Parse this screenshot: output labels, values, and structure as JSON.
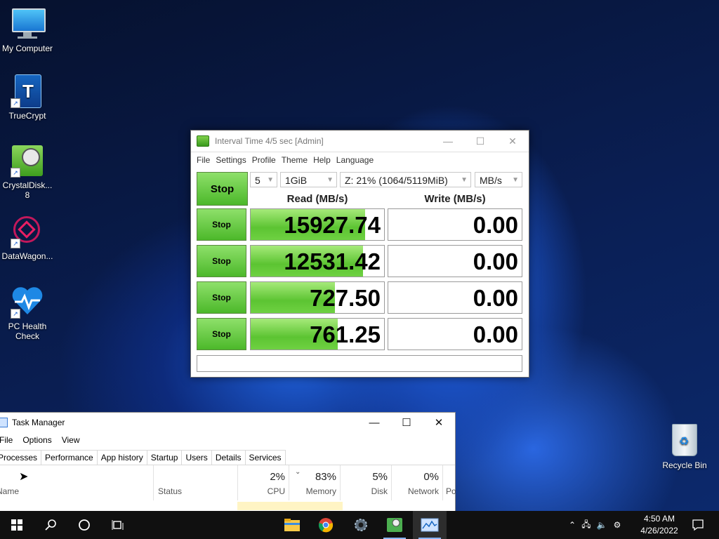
{
  "desktop": {
    "icons": [
      {
        "label": "My Computer"
      },
      {
        "label": "TrueCrypt"
      },
      {
        "label": "CrystalDisk...\n8"
      },
      {
        "label": "DataWagon..."
      },
      {
        "label": "PC Health\nCheck"
      }
    ],
    "recycle_bin": "Recycle Bin"
  },
  "cdm": {
    "title": "Interval Time 4/5 sec [Admin]",
    "menu": [
      "File",
      "Settings",
      "Profile",
      "Theme",
      "Help",
      "Language"
    ],
    "all_button": "Stop",
    "count": "5",
    "size": "1GiB",
    "drive": "Z: 21% (1064/5119MiB)",
    "unit": "MB/s",
    "read_header": "Read (MB/s)",
    "write_header": "Write (MB/s)",
    "rows": [
      {
        "button": "Stop",
        "read": "15927.74",
        "write": "0.00",
        "read_fill": 0.86
      },
      {
        "button": "Stop",
        "read": "12531.42",
        "write": "0.00",
        "read_fill": 0.84
      },
      {
        "button": "Stop",
        "read": "727.50",
        "write": "0.00",
        "read_fill": 0.63
      },
      {
        "button": "Stop",
        "read": "761.25",
        "write": "0.00",
        "read_fill": 0.65
      }
    ],
    "status": "",
    "colors": {
      "button_green": "#5cc432",
      "bar_green": "#6fd142"
    }
  },
  "task_manager": {
    "title": "Task Manager",
    "menu": [
      "File",
      "Options",
      "View"
    ],
    "tabs": [
      "Processes",
      "Performance",
      "App history",
      "Startup",
      "Users",
      "Details",
      "Services"
    ],
    "columns": {
      "name": "Name",
      "status": "Status",
      "cpu": {
        "pct": "2%",
        "label": "CPU"
      },
      "memory": {
        "pct": "83%",
        "label": "Memory"
      },
      "disk": {
        "pct": "5%",
        "label": "Disk"
      },
      "network": {
        "pct": "0%",
        "label": "Network"
      },
      "power": "Po"
    }
  },
  "taskbar": {
    "icons": [
      "windows-start-icon",
      "search-icon",
      "cortana-icon",
      "task-view-icon",
      "file-explorer-icon",
      "chrome-icon",
      "settings-icon",
      "crystaldiskmark-icon",
      "task-manager-icon"
    ],
    "time": "4:50 AM",
    "date": "4/26/2022"
  }
}
